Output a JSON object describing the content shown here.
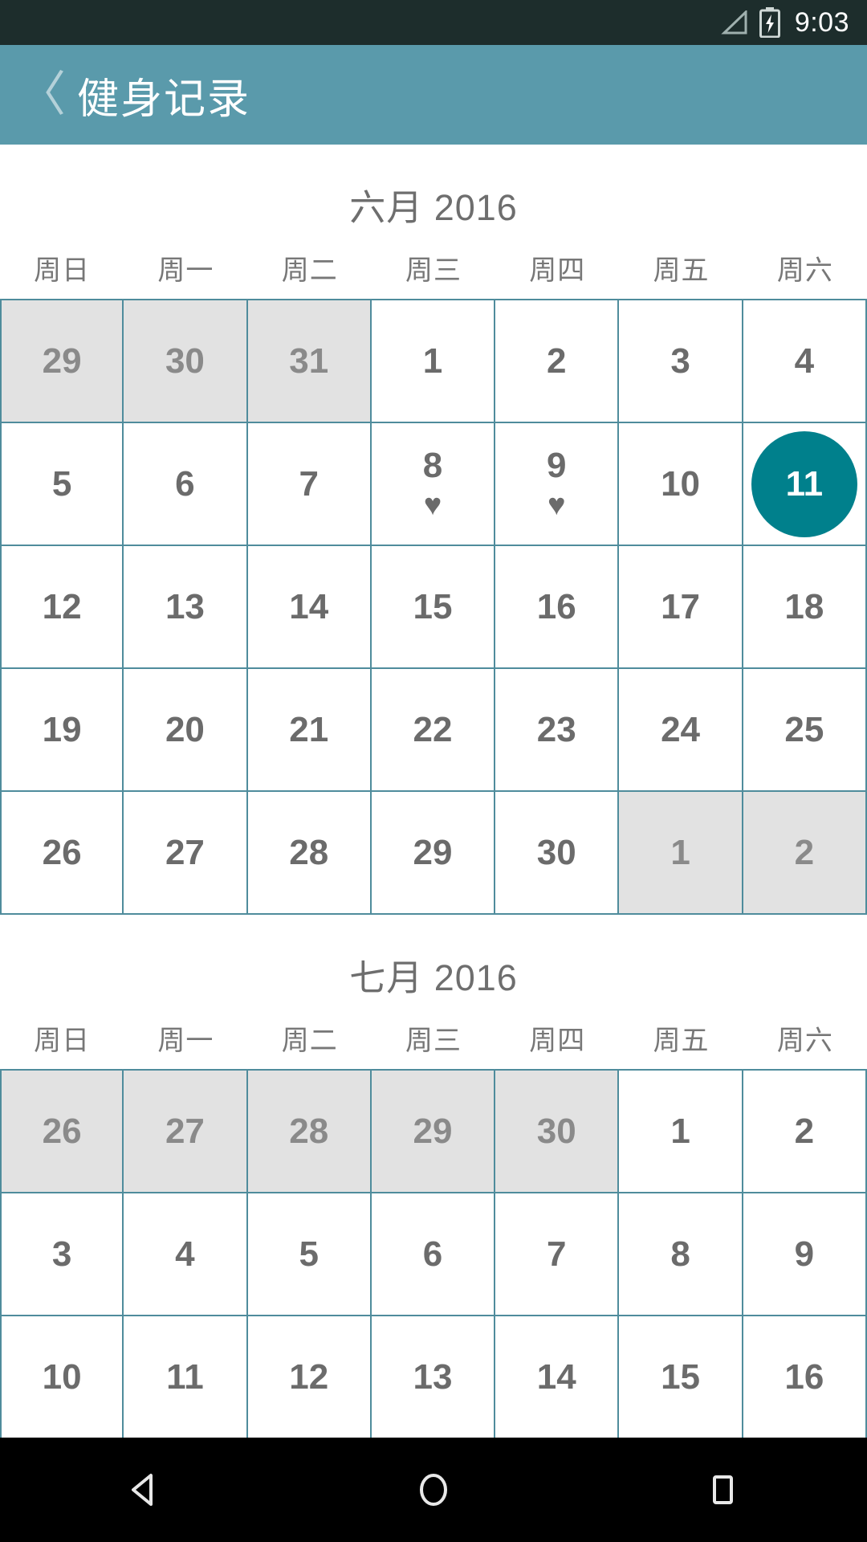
{
  "status_bar": {
    "time": "9:03",
    "signal_icon": "signal-triangle-icon",
    "battery_icon": "battery-charging-icon"
  },
  "action_bar": {
    "back_icon": "〈",
    "back_icon_name": "back-chevron-icon",
    "title": "健身记录"
  },
  "colors": {
    "status_bar_bg": "#1d2d2c",
    "action_bar_bg": "#5a9aab",
    "grid_line": "#4f8c9c",
    "adjacent_day_bg": "#e2e2e2",
    "selected_day_bg": "#00808c",
    "day_text": "#6b6b6b",
    "nav_bar_bg": "#000000"
  },
  "weekdays": [
    "周日",
    "周一",
    "周二",
    "周三",
    "周四",
    "周五",
    "周六"
  ],
  "months": [
    {
      "title": "六月 2016",
      "weeks": [
        [
          {
            "day": "29",
            "adjacent": true
          },
          {
            "day": "30",
            "adjacent": true
          },
          {
            "day": "31",
            "adjacent": true
          },
          {
            "day": "1"
          },
          {
            "day": "2"
          },
          {
            "day": "3"
          },
          {
            "day": "4"
          }
        ],
        [
          {
            "day": "5"
          },
          {
            "day": "6"
          },
          {
            "day": "7"
          },
          {
            "day": "8",
            "marker": "♥"
          },
          {
            "day": "9",
            "marker": "♥"
          },
          {
            "day": "10"
          },
          {
            "day": "11",
            "selected": true
          }
        ],
        [
          {
            "day": "12"
          },
          {
            "day": "13"
          },
          {
            "day": "14"
          },
          {
            "day": "15"
          },
          {
            "day": "16"
          },
          {
            "day": "17"
          },
          {
            "day": "18"
          }
        ],
        [
          {
            "day": "19"
          },
          {
            "day": "20"
          },
          {
            "day": "21"
          },
          {
            "day": "22"
          },
          {
            "day": "23"
          },
          {
            "day": "24"
          },
          {
            "day": "25"
          }
        ],
        [
          {
            "day": "26"
          },
          {
            "day": "27"
          },
          {
            "day": "28"
          },
          {
            "day": "29"
          },
          {
            "day": "30"
          },
          {
            "day": "1",
            "adjacent": true
          },
          {
            "day": "2",
            "adjacent": true
          }
        ]
      ]
    },
    {
      "title": "七月 2016",
      "weeks": [
        [
          {
            "day": "26",
            "adjacent": true
          },
          {
            "day": "27",
            "adjacent": true
          },
          {
            "day": "28",
            "adjacent": true
          },
          {
            "day": "29",
            "adjacent": true
          },
          {
            "day": "30",
            "adjacent": true
          },
          {
            "day": "1"
          },
          {
            "day": "2"
          }
        ],
        [
          {
            "day": "3"
          },
          {
            "day": "4"
          },
          {
            "day": "5"
          },
          {
            "day": "6"
          },
          {
            "day": "7"
          },
          {
            "day": "8"
          },
          {
            "day": "9"
          }
        ],
        [
          {
            "day": "10"
          },
          {
            "day": "11"
          },
          {
            "day": "12"
          },
          {
            "day": "13"
          },
          {
            "day": "14"
          },
          {
            "day": "15"
          },
          {
            "day": "16"
          }
        ]
      ]
    }
  ],
  "nav_bar": {
    "back_label": "back-triangle-icon",
    "home_label": "home-circle-icon",
    "recents_label": "recents-square-icon"
  }
}
